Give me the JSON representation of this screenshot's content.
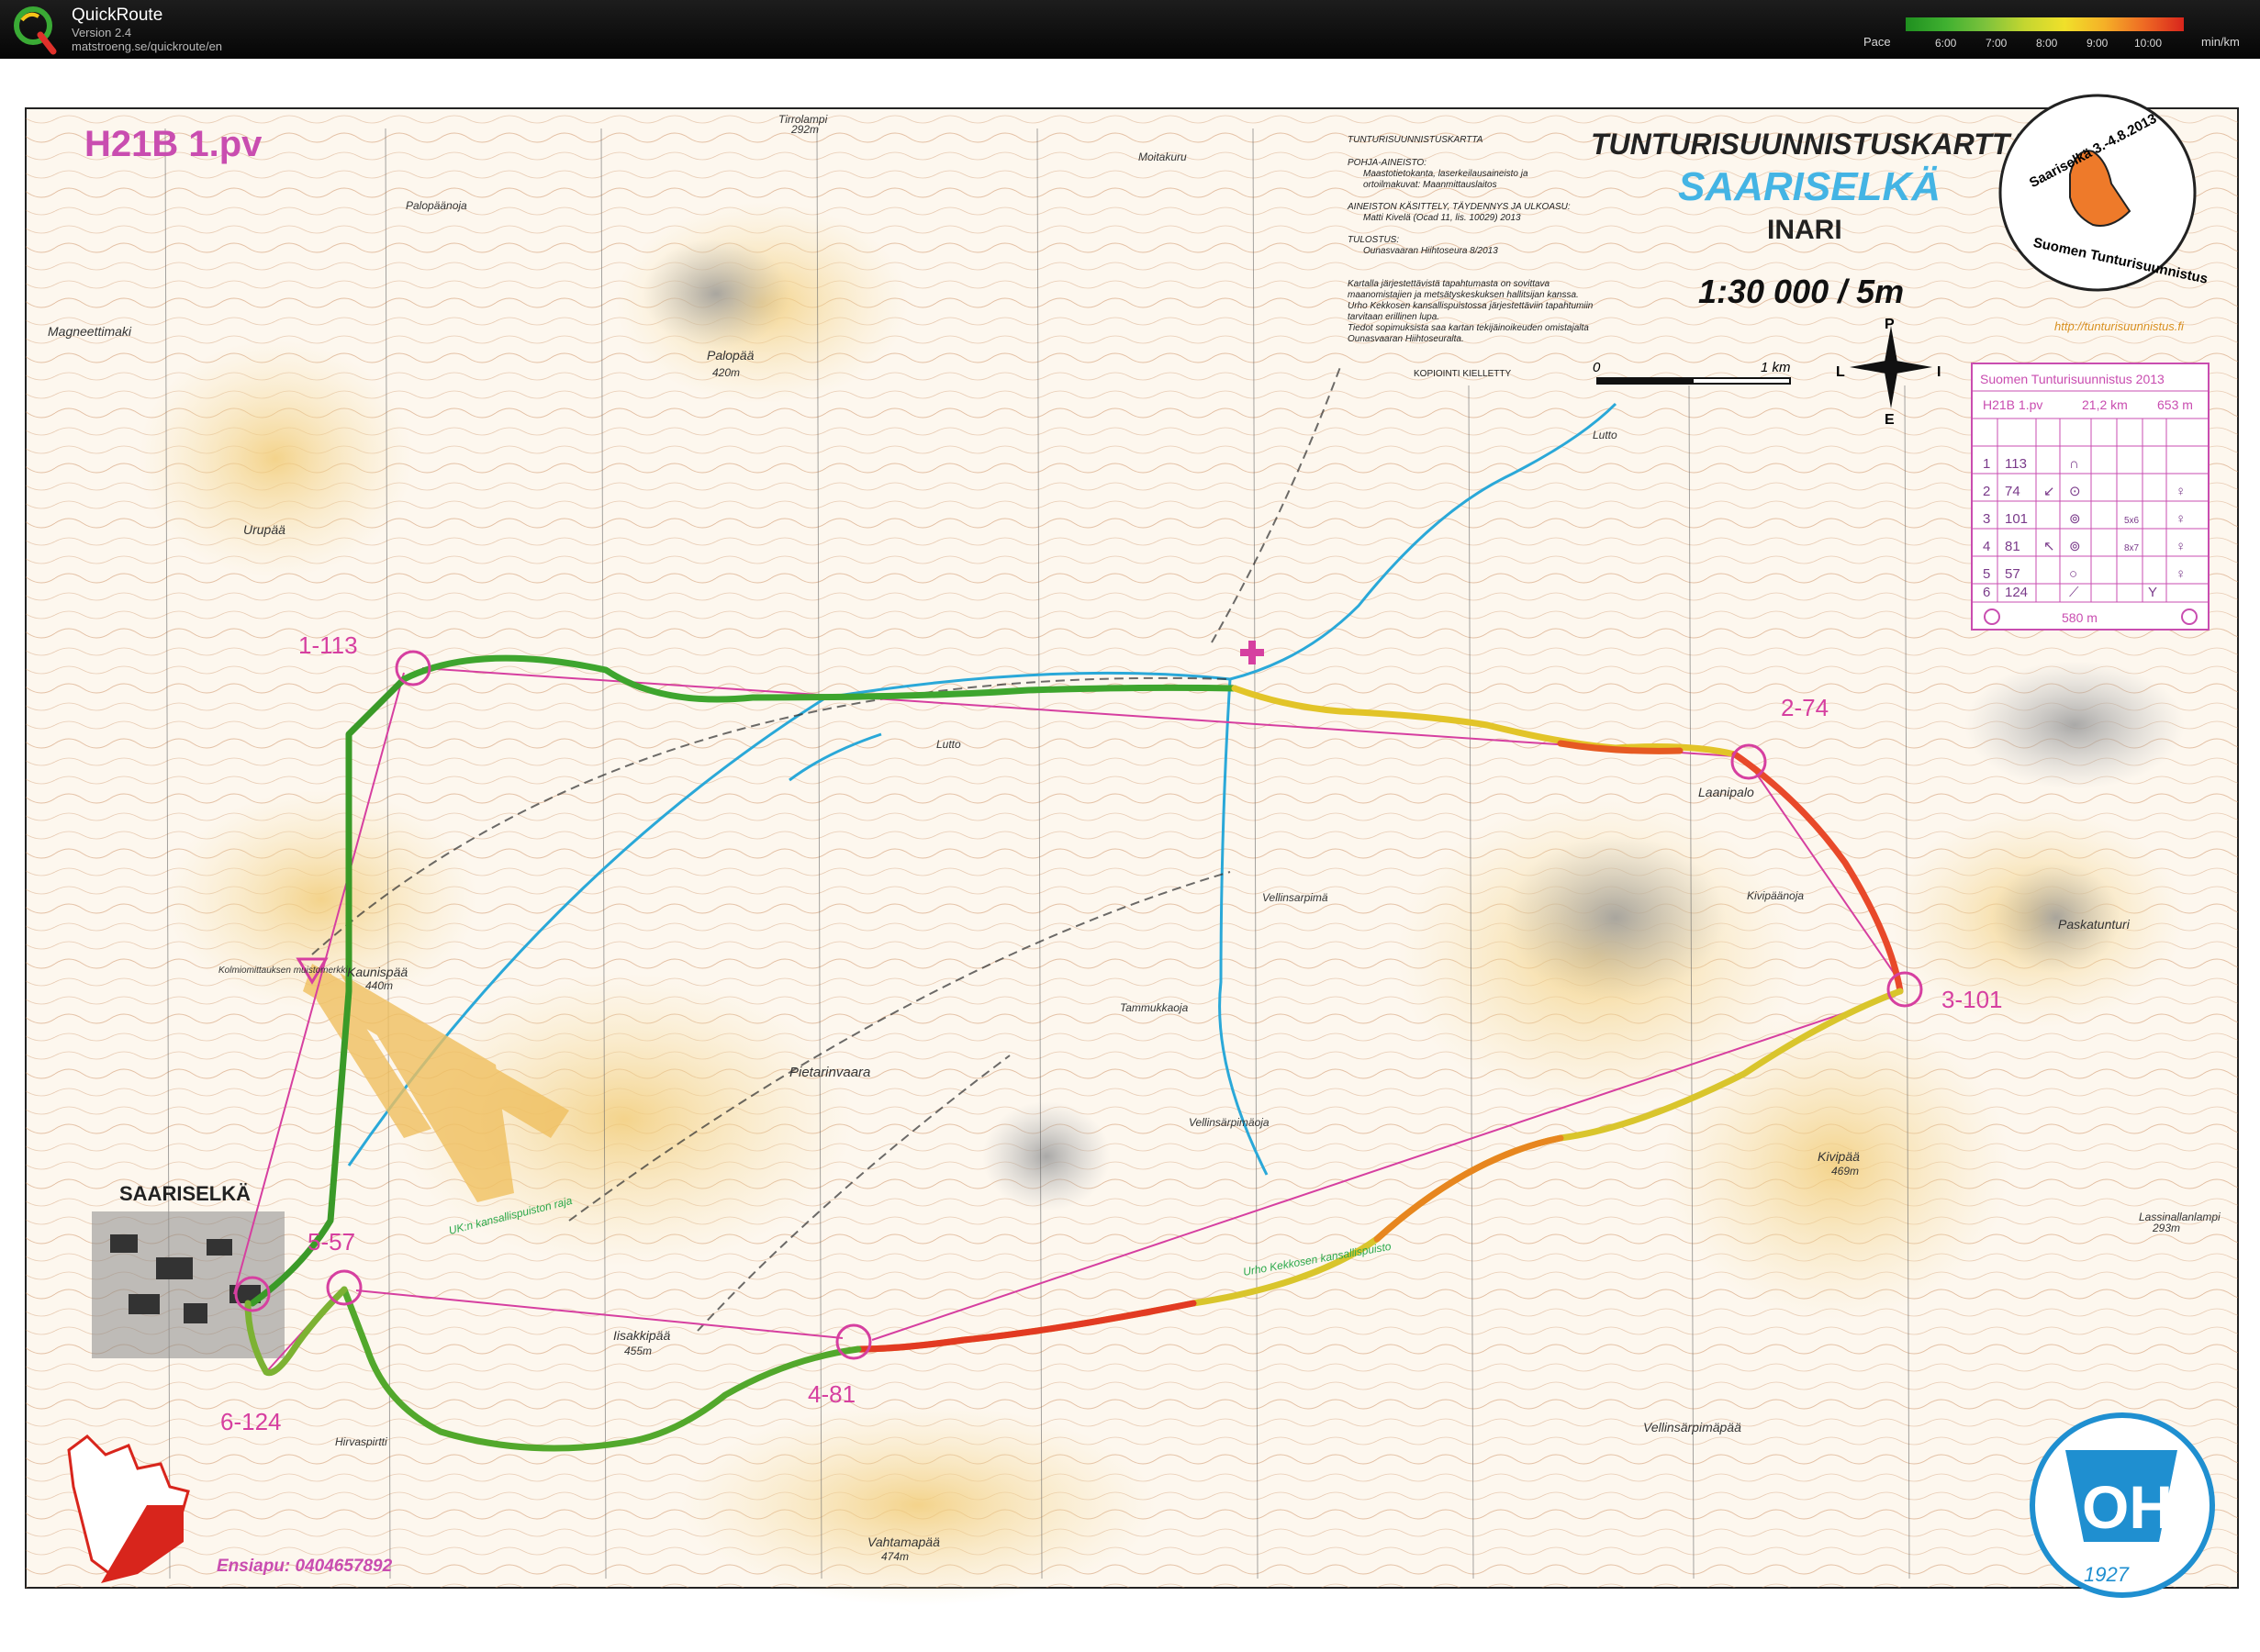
{
  "app": {
    "title": "QuickRoute",
    "version": "Version 2.4",
    "url": "matstroeng.se/quickroute/en"
  },
  "pace_legend": {
    "label": "Pace",
    "ticks": [
      "6:00",
      "7:00",
      "8:00",
      "9:00",
      "10:00"
    ],
    "unit": "min/km"
  },
  "map": {
    "course_title": "H21B 1.pv",
    "header_title": "TUNTURISUUNNISTUSKARTTA",
    "area_name": "SAARISELKÄ",
    "municipality": "INARI",
    "scale": "1:30 000 / 5m",
    "credits": {
      "line1": "TUNTURISUUNNISTUSKARTTA",
      "line2": "POHJA-AINEISTO:",
      "line3": "Maastotietokanta, laserkeilausaineisto ja",
      "line4": "ortoilmakuvat: Maanmittauslaitos",
      "line5": "AINEISTON KÄSITTELY, TÄYDENNYS JA ULKOASU:",
      "line6": "Matti Kivelä (Ocad 11, lis. 10029) 2013",
      "line7": "TULOSTUS:",
      "line8": "Ounasvaaran Hiihtoseura 8/2013",
      "line9": "Kartalla järjestettävistä tapahtumasta on sovittava",
      "line10": "maanomistajien ja metsätyskeskuksen hallitsijan kanssa.",
      "line11": "Urho Kekkosen kansallispuistossa järjestettäviin tapahtumiin",
      "line12": "tarvitaan erillinen lupa.",
      "line13": "Tiedot sopimuksista saa kartan tekijäinoikeuden omistajalta",
      "line14": "Ounasvaaran Hiihtoseuralta.",
      "copy": "KOPIOINTI KIELLETTY"
    },
    "scale_bar": {
      "start": "0",
      "end": "1 km"
    },
    "compass": {
      "n": "P",
      "s": "E",
      "w": "L",
      "e": "I"
    },
    "website": "http://tunturisuunnistus.fi",
    "badge": {
      "top": "Saariselkä 3.-4.8.2013",
      "bottom": "Suomen Tunturisuunnistus"
    },
    "emergency": "Ensiapu: 0404657892",
    "oh_logo": {
      "letters": "OH",
      "year": "1927"
    },
    "controls": [
      {
        "label": "1-113"
      },
      {
        "label": "2-74"
      },
      {
        "label": "3-101"
      },
      {
        "label": "4-81"
      },
      {
        "label": "5-57"
      },
      {
        "label": "6-124"
      }
    ],
    "description_table": {
      "title": "Suomen Tunturisuunnistus 2013",
      "course": "H21B 1.pv",
      "length": "21,2 km",
      "climb": "653 m",
      "rows": [
        {
          "num": "1",
          "code": "113",
          "dir": "",
          "feature": "∩",
          "size": "",
          "detail": ""
        },
        {
          "num": "2",
          "code": "74",
          "dir": "↙",
          "feature": "⊙",
          "size": "",
          "detail": "♀"
        },
        {
          "num": "3",
          "code": "101",
          "dir": "",
          "feature": "⊚",
          "size": "5x6",
          "detail": "♀"
        },
        {
          "num": "4",
          "code": "81",
          "dir": "↖",
          "feature": "⊚",
          "size": "8x7",
          "detail": "♀"
        },
        {
          "num": "5",
          "code": "57",
          "dir": "",
          "feature": "○",
          "size": "",
          "detail": "♀"
        },
        {
          "num": "6",
          "code": "124",
          "dir": "",
          "feature": "⟋",
          "size": "",
          "detail": "Y"
        }
      ],
      "finish": "580 m"
    },
    "place_names": [
      "Tirrolampi",
      "292m",
      "Moitakuru",
      "Palopäänoja",
      "Magneettimaki",
      "Palopää",
      "420m",
      "Urupää",
      "Lutto",
      "Laanipalo",
      "Kivipäänoja",
      "Paskatunturi",
      "Vellinsarpimä",
      "Kaunispää",
      "440m",
      "Kolmiomittauksen muistomerkki",
      "Tammukkaoja",
      "Pietarinvaara",
      "Vellinsärpimäoja",
      "UK:n kansallispuiston raja",
      "Kivipää",
      "469m",
      "Lassinallanlampi",
      "293m",
      "SAARISELKÄ",
      "Urho Kekkosen kansallispuisto",
      "Iisakkipää",
      "455m",
      "Hirvaspirtti",
      "Vellinsärpimäpää",
      "Vahtamapää",
      "474m",
      "Lutto"
    ]
  }
}
